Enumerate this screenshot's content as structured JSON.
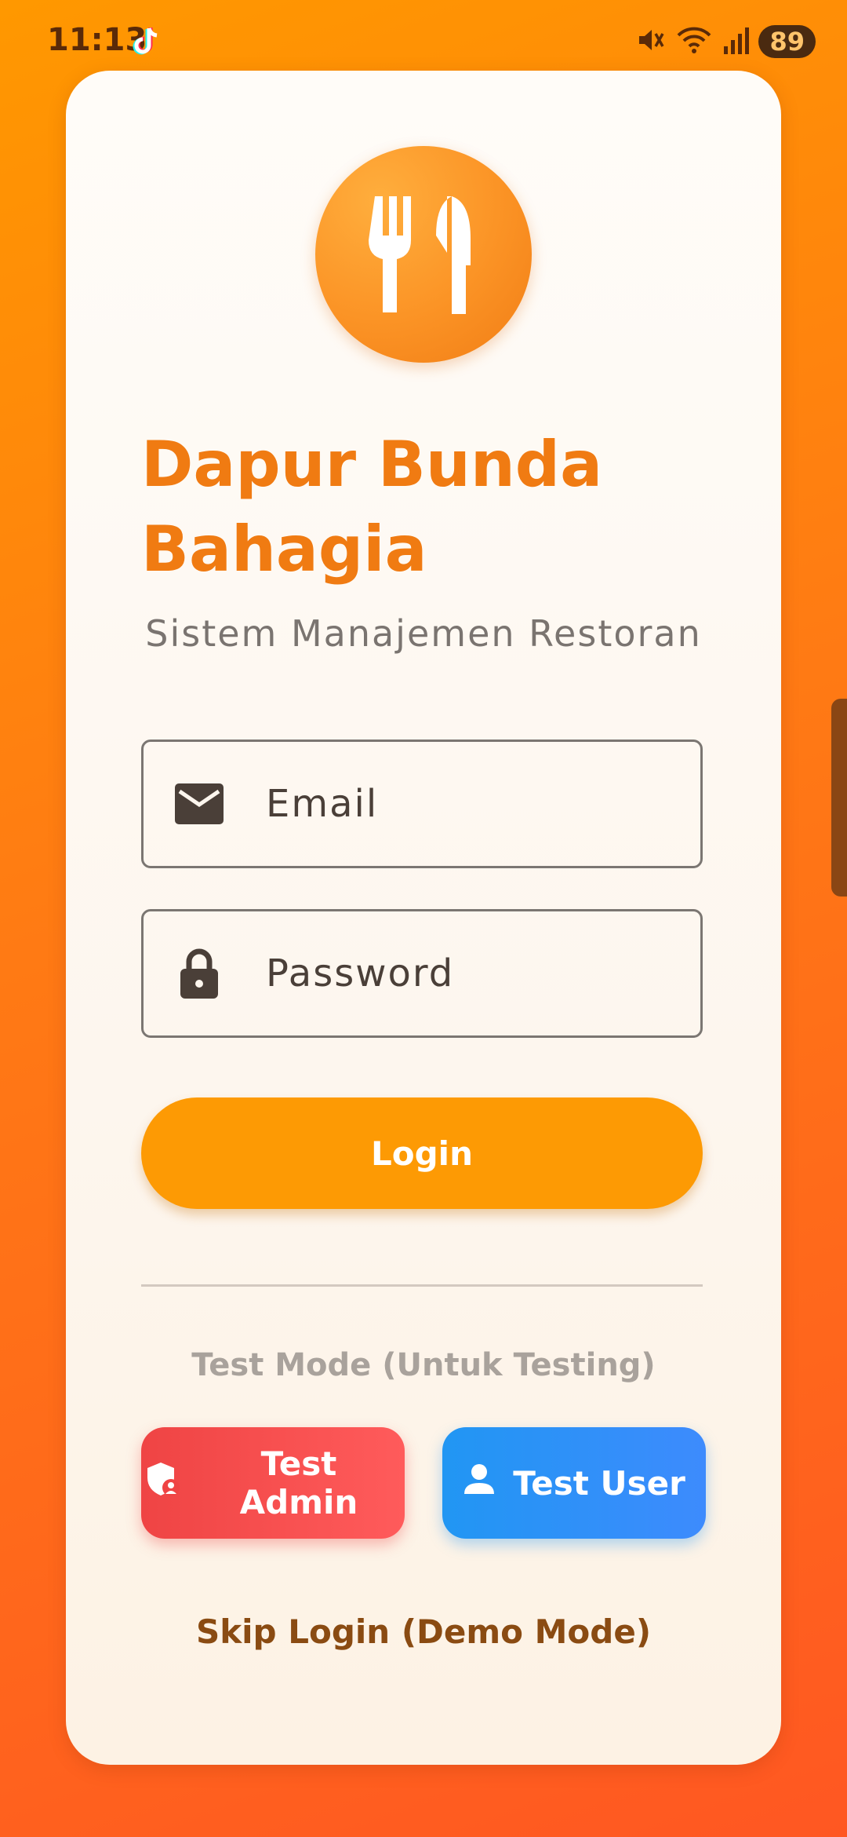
{
  "status_bar": {
    "time": "11:13",
    "battery": "89",
    "icons": [
      "tiktok-icon",
      "mute-icon",
      "wifi-icon",
      "signal-icon"
    ]
  },
  "app": {
    "logo_icon": "fork-knife-icon",
    "title": "Dapur Bunda Bahagia",
    "subtitle": "Sistem Manajemen Restoran"
  },
  "form": {
    "email": {
      "placeholder": "Email",
      "value": "",
      "icon": "email-icon"
    },
    "password": {
      "placeholder": "Password",
      "value": "",
      "icon": "lock-icon"
    },
    "login_label": "Login"
  },
  "test_mode": {
    "label": "Test Mode (Untuk Testing)",
    "admin_label": "Test Admin",
    "user_label": "Test User"
  },
  "skip_label": "Skip Login (Demo Mode)",
  "colors": {
    "accent": "#fd9a04",
    "title": "#f07b12",
    "admin": "#ef4444",
    "user": "#2196f3",
    "skip": "#8a4b12"
  }
}
